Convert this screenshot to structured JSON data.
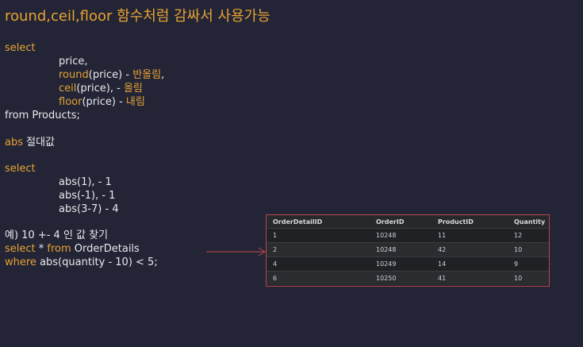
{
  "title": "round,ceil,floor 함수처럼 감싸서 사용가능",
  "block1": {
    "select": "select",
    "price": "price,",
    "round_fn": "round",
    "round_rest": "(price) - ",
    "round_desc": "반올림",
    "round_end": ",",
    "ceil_fn": "ceil",
    "ceil_rest": "(price), - ",
    "ceil_desc": "올림",
    "floor_fn": "floor",
    "floor_rest": "(price) - ",
    "floor_desc": "내림",
    "from": "from Products;"
  },
  "abs_heading": {
    "kw": "abs",
    "text": " 절대값"
  },
  "block2": {
    "select": "select",
    "l1": "abs(1),  - 1",
    "l2": "abs(-1), - 1",
    "l3": "abs(3-7) - 4"
  },
  "example": {
    "desc": "예) 10 +- 4 인 값 찾기",
    "select": "select",
    "star": " * ",
    "from": "from",
    "table": " OrderDetails",
    "where": "where",
    "cond": " abs(quantity - 10) < 5;"
  },
  "result_table": {
    "headers": [
      "OrderDetailID",
      "OrderID",
      "ProductID",
      "Quantity"
    ],
    "rows": [
      [
        "1",
        "10248",
        "11",
        "12"
      ],
      [
        "2",
        "10248",
        "42",
        "10"
      ],
      [
        "4",
        "10249",
        "14",
        "9"
      ],
      [
        "6",
        "10250",
        "41",
        "10"
      ]
    ]
  },
  "colors": {
    "background": "#232536",
    "keyword": "#e7a233",
    "text": "#e8e8ec",
    "table_border": "#b5474b",
    "arrow": "#c0454a"
  }
}
